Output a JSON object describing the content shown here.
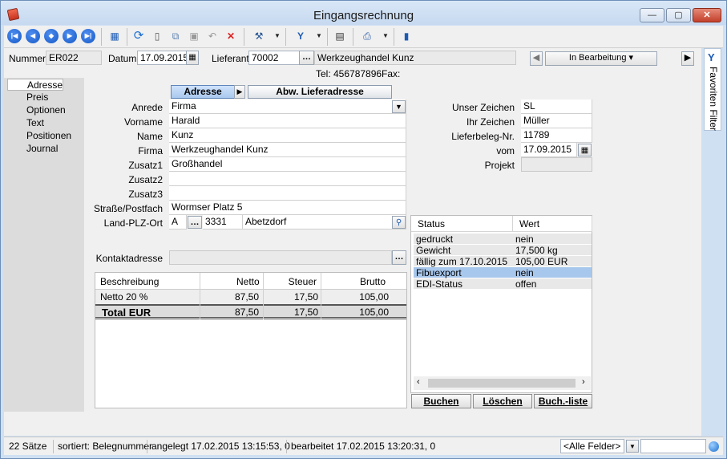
{
  "window": {
    "title": "Eingangsrechnung",
    "min": "—",
    "max": "▢",
    "close": "✕"
  },
  "toolbar": {
    "icons": [
      "first-icon",
      "prev-icon",
      "toggle-icon",
      "next-icon",
      "last-icon",
      "grid-icon",
      "refresh-icon",
      "new-icon",
      "copy-icon",
      "save-icon",
      "undo-icon",
      "delete-icon",
      "tools-icon",
      "filter-icon",
      "report-icon",
      "print-icon",
      "book-icon"
    ]
  },
  "header": {
    "nummer_label": "Nummer",
    "nummer": "ER022",
    "datum_label": "Datum",
    "datum": "17.09.2015",
    "lieferant_label": "Lieferant",
    "lieferant_nr": "70002",
    "lieferant_name": "Werkzeughandel Kunz",
    "tel": "Tel: 456787896",
    "fax": "Fax:",
    "status_value": "In Bearbeitung"
  },
  "nav": {
    "items": [
      "Adresse",
      "Preis",
      "Optionen",
      "Text",
      "Positionen",
      "Journal"
    ]
  },
  "tabs": {
    "adresse": "Adresse",
    "abw": "Abw. Lieferadresse"
  },
  "address": {
    "anrede_label": "Anrede",
    "anrede": "Firma",
    "vorname_label": "Vorname",
    "vorname": "Harald",
    "name_label": "Name",
    "name": "Kunz",
    "firma_label": "Firma",
    "firma": "Werkzeughandel Kunz",
    "zusatz1_label": "Zusatz1",
    "zusatz1": "Großhandel",
    "zusatz2_label": "Zusatz2",
    "zusatz2": "",
    "zusatz3_label": "Zusatz3",
    "zusatz3": "",
    "strasse_label": "Straße/Postfach",
    "strasse": "Wormser Platz 5",
    "ort_label": "Land-PLZ-Ort",
    "land": "A",
    "plz": "3331",
    "ort": "Abetzdorf",
    "kontakt_label": "Kontaktadresse",
    "kontakt": ""
  },
  "right": {
    "unser_label": "Unser Zeichen",
    "unser": "SL",
    "ihr_label": "Ihr Zeichen",
    "ihr": "Müller",
    "beleg_label": "Lieferbeleg-Nr.",
    "beleg": "11789",
    "vom_label": "vom",
    "vom": "17.09.2015",
    "projekt_label": "Projekt",
    "projekt": ""
  },
  "totals": {
    "headers": [
      "Beschreibung",
      "Netto",
      "Steuer",
      "Brutto"
    ],
    "row1": [
      "Netto 20 %",
      "87,50",
      "17,50",
      "105,00"
    ],
    "total": [
      "Total EUR",
      "87,50",
      "17,50",
      "105,00"
    ]
  },
  "statusgrid": {
    "headers": [
      "Status",
      "Wert"
    ],
    "rows": [
      [
        "gedruckt",
        "nein"
      ],
      [
        "Gewicht",
        "17,500 kg"
      ],
      [
        "fällig zum 17.10.2015",
        "105,00 EUR"
      ],
      [
        "Fibuexport",
        "nein"
      ],
      [
        "EDI-Status",
        "offen"
      ]
    ],
    "buttons": [
      "Buchen",
      "Löschen",
      "Buch.-liste"
    ]
  },
  "sidetab": "Favoriten Filter",
  "statusbar": {
    "saetze": "22 Sätze",
    "sort": "sortiert: Belegnummer",
    "angelegt": "angelegt 17.02.2015 13:15:53,  0",
    "bearbeitet": "bearbeitet 17.02.2015 13:20:31,  0",
    "filter": "<Alle Felder>"
  }
}
